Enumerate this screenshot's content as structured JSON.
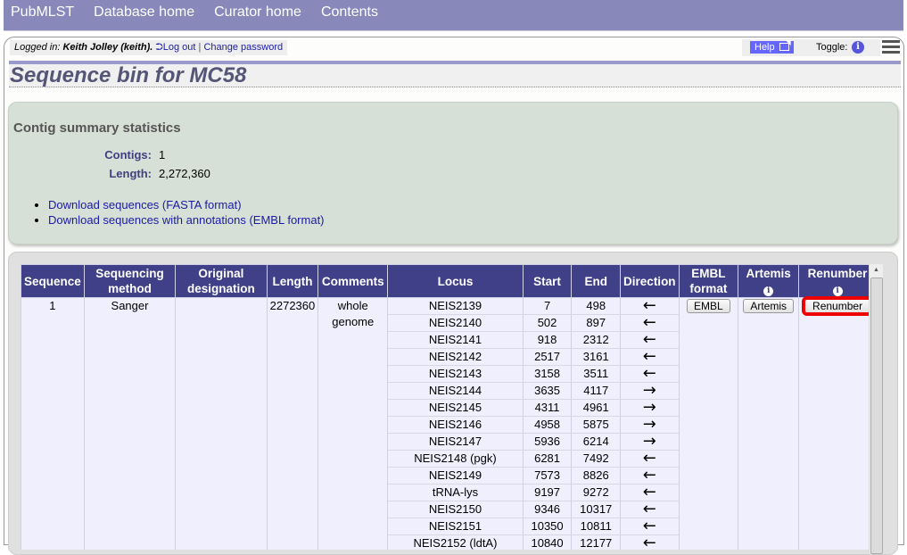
{
  "nav": {
    "items": [
      "PubMLST",
      "Database home",
      "Curator home",
      "Contents"
    ]
  },
  "session": {
    "logged_in_prefix": "Logged in:",
    "user": "Keith Jolley (keith).",
    "logout": "Log out",
    "separator": "|",
    "change_password": "Change password"
  },
  "tools": {
    "help": "Help",
    "toggle": "Toggle:",
    "info_glyph": "i"
  },
  "page": {
    "title": "Sequence bin for MC58"
  },
  "summary": {
    "heading": "Contig summary statistics",
    "stats": [
      {
        "label": "Contigs:",
        "value": "1"
      },
      {
        "label": "Length:",
        "value": "2,272,360"
      }
    ],
    "links": [
      "Download sequences (FASTA format)",
      "Download sequences with annotations (EMBL format)"
    ]
  },
  "table": {
    "headers": {
      "sequence": "Sequence",
      "method": "Sequencing method",
      "original": "Original designation",
      "length": "Length",
      "comments": "Comments",
      "locus": "Locus",
      "start": "Start",
      "end": "End",
      "direction": "Direction",
      "embl": "EMBL format",
      "artemis": "Artemis",
      "renumber": "Renumber"
    },
    "contig": {
      "sequence": "1",
      "method": "Sanger",
      "original": "",
      "length": "2272360",
      "comments": "whole genome",
      "embl_button": "EMBL",
      "artemis_button": "Artemis",
      "renumber_button": "Renumber"
    },
    "loci": [
      {
        "locus": "NEIS2139",
        "start": "7",
        "end": "498",
        "direction": "←"
      },
      {
        "locus": "NEIS2140",
        "start": "502",
        "end": "897",
        "direction": "←"
      },
      {
        "locus": "NEIS2141",
        "start": "918",
        "end": "2312",
        "direction": "←"
      },
      {
        "locus": "NEIS2142",
        "start": "2517",
        "end": "3161",
        "direction": "←"
      },
      {
        "locus": "NEIS2143",
        "start": "3158",
        "end": "3511",
        "direction": "←"
      },
      {
        "locus": "NEIS2144",
        "start": "3635",
        "end": "4117",
        "direction": "→"
      },
      {
        "locus": "NEIS2145",
        "start": "4311",
        "end": "4961",
        "direction": "→"
      },
      {
        "locus": "NEIS2146",
        "start": "4958",
        "end": "5875",
        "direction": "→"
      },
      {
        "locus": "NEIS2147",
        "start": "5936",
        "end": "6214",
        "direction": "→"
      },
      {
        "locus": "NEIS2148 (pgk)",
        "start": "6281",
        "end": "7492",
        "direction": "←"
      },
      {
        "locus": "NEIS2149",
        "start": "7573",
        "end": "8826",
        "direction": "←"
      },
      {
        "locus": "tRNA-lys",
        "start": "9197",
        "end": "9272",
        "direction": "←"
      },
      {
        "locus": "NEIS2150",
        "start": "9346",
        "end": "10317",
        "direction": "←"
      },
      {
        "locus": "NEIS2151",
        "start": "10350",
        "end": "10811",
        "direction": "←"
      },
      {
        "locus": "NEIS2152 (ldtA)",
        "start": "10840",
        "end": "12177",
        "direction": "←"
      }
    ]
  }
}
